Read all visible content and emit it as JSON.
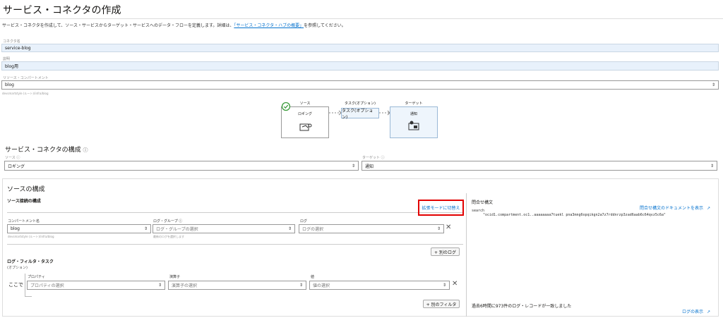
{
  "page": {
    "title": "サービス・コネクタの作成",
    "intro_text": "サービス・コネクタを作成して、ソース・サービスからターゲット・サービスへのデータ・フローを定義します。詳細は、",
    "intro_link": "「サービス・コネクタ・ハブの概要」",
    "intro_suffix": "を参照してください。"
  },
  "form": {
    "connector_name_label": "コネクタ名",
    "connector_name_value": "service-blog",
    "description_label": "説明",
    "description_value": "blog用",
    "compartment_label": "リソース・コンパートメント",
    "compartment_value": "blog",
    "compartment_path": "devsmartstyle (ルート)/infra/blog"
  },
  "flow": {
    "source_title": "ソース",
    "source_name": "ロギング",
    "task_title": "タスク(オプション)",
    "task_name": "タスク(オプション)",
    "target_title": "ターゲット",
    "target_name": "通知"
  },
  "config": {
    "title": "サービス・コネクタの構成",
    "source_label": "ソース",
    "source_value": "ロギング",
    "target_label": "ターゲット",
    "target_value": "通知"
  },
  "source_config": {
    "title": "ソースの構成",
    "connection_title": "ソース接続の構成",
    "advanced_mode_link": "拡張モードに切替え",
    "compartment_label": "コンパートメント名",
    "compartment_value": "blog",
    "compartment_path": "devsmartstyle (ルート)/infra/blog",
    "log_group_label": "ログ・グループ",
    "log_group_placeholder": "ログ・グループの選択",
    "log_group_help": "最新のログを選択します",
    "log_label": "ログ",
    "log_placeholder": "ログの選択",
    "add_log_button": "+ 別のログ",
    "filter_title": "ログ・フィルタ・タスク",
    "filter_optional": "(オプション)",
    "filter_where": "ここで",
    "property_label": "プロパティ",
    "property_placeholder": "プロパティの選択",
    "operator_label": "演算子",
    "operator_placeholder": "演算子の選択",
    "value_label": "値",
    "value_placeholder": "値の選択",
    "add_filter_button": "+ 別のフィルタ"
  },
  "query": {
    "title": "問合せ構文",
    "docs_link": "問合せ構文のドキュメントを表示",
    "line1": "search",
    "line2": "\"ocid1.compartment.oc1..aaaaaaaa7tuekl pna3mng6opqikgn2a7z7rddnrzp3zad6aab6c64qvz5c6a\"",
    "result_text": "過去6時間に973件のログ・レコードが一致しました",
    "log_link": "ログの表示"
  }
}
